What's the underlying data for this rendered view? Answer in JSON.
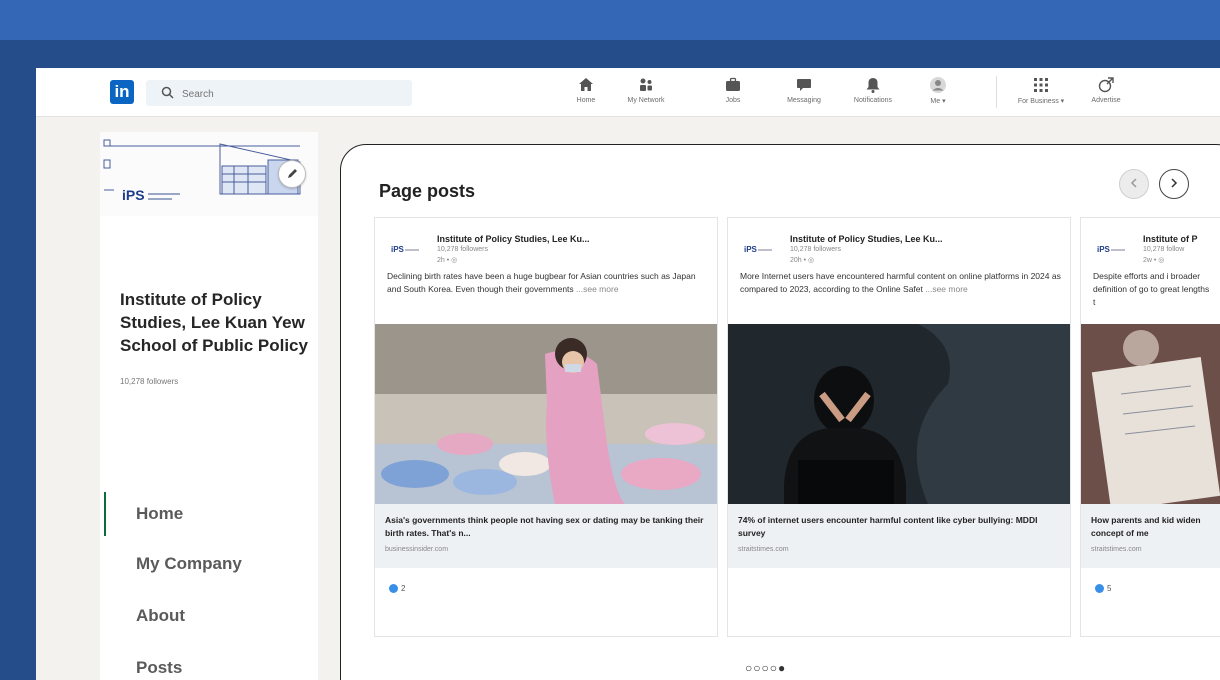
{
  "nav": {
    "logo": "in",
    "search_placeholder": "Search",
    "items": [
      {
        "label": "Home",
        "icon": "home-icon"
      },
      {
        "label": "My Network",
        "icon": "network-icon"
      },
      {
        "label": "Jobs",
        "icon": "briefcase-icon"
      },
      {
        "label": "Messaging",
        "icon": "chat-icon"
      },
      {
        "label": "Notifications",
        "icon": "bell-icon"
      },
      {
        "label": "Me ▾",
        "icon": "avatar-icon"
      },
      {
        "label": "For Business ▾",
        "icon": "grid-icon"
      },
      {
        "label": "Advertise",
        "icon": "advertise-icon"
      }
    ]
  },
  "sidebar": {
    "org_name": "Institute of Policy Studies, Lee Kuan Yew School of Public Policy",
    "followers": "10,278 followers",
    "menu": [
      "Home",
      "My Company",
      "About",
      "Posts"
    ]
  },
  "card": {
    "title": "Page posts",
    "pagination": "○○○○●",
    "posts": [
      {
        "author": "Institute of Policy Studies, Lee Ku...",
        "followers": "10,278 followers",
        "time": "2h • ◎",
        "text": "Declining birth rates have been a huge bugbear for Asian countries such as Japan and South Korea. Even though their governments",
        "more": "...see more",
        "headline": "Asia's governments think people not having sex or dating may be tanking their birth rates. That's n...",
        "source": "businessinsider.com",
        "reactions": "2"
      },
      {
        "author": "Institute of Policy Studies, Lee Ku...",
        "followers": "10,278 followers",
        "time": "20h • ◎",
        "text": "More Internet users have encountered harmful content on online platforms in 2024 as compared to 2023, according to the Online Safet",
        "more": "...see more",
        "headline": "74% of internet users encounter harmful content like cyber bullying: MDDI survey",
        "source": "straitstimes.com",
        "reactions": ""
      },
      {
        "author": "Institute of P",
        "followers": "10,278 follow",
        "time": "2w • ◎",
        "text": "Despite efforts and i broader definition of go to great lengths t",
        "more": "",
        "headline": "How parents and kid widen concept of me",
        "source": "straitstimes.com",
        "reactions": "5"
      }
    ]
  },
  "colors": {
    "frame_bg": "#2d5a9e",
    "linkedin_blue": "#0a66c2",
    "page_bg": "#f4f2ee",
    "menu_indicator": "#0b6b3a",
    "reaction_blue": "#378fe9"
  }
}
